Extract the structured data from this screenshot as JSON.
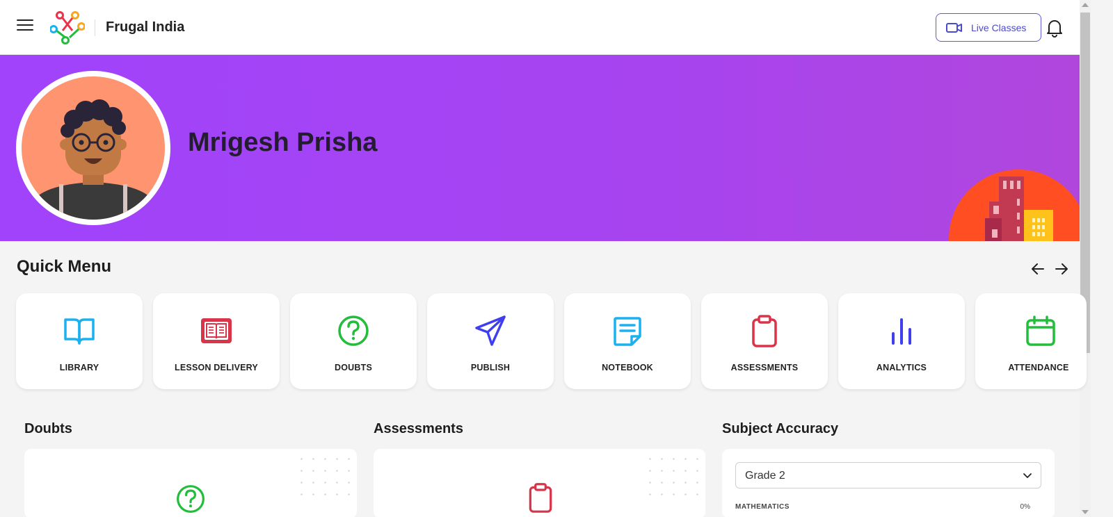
{
  "header": {
    "brand": "Frugal India",
    "live_classes_label": "Live Classes"
  },
  "profile": {
    "name": "Mrigesh Prisha"
  },
  "quick_menu": {
    "title": "Quick Menu",
    "items": [
      {
        "label": "LIBRARY",
        "icon": "book-open-icon",
        "color": "#1ab1f0"
      },
      {
        "label": "LESSON DELIVERY",
        "icon": "book-lesson-icon",
        "color": "#d8344a"
      },
      {
        "label": "DOUBTS",
        "icon": "question-circle-icon",
        "color": "#22bd3b"
      },
      {
        "label": "PUBLISH",
        "icon": "send-icon",
        "color": "#3f3ff0"
      },
      {
        "label": "NOTEBOOK",
        "icon": "notebook-icon",
        "color": "#1ab1f0"
      },
      {
        "label": "ASSESSMENTS",
        "icon": "clipboard-icon",
        "color": "#d8344a"
      },
      {
        "label": "ANALYTICS",
        "icon": "bar-chart-icon",
        "color": "#3f3ff0"
      },
      {
        "label": "ATTENDANCE",
        "icon": "calendar-icon",
        "color": "#22bd3b"
      }
    ]
  },
  "dashboard": {
    "doubts_title": "Doubts",
    "assessments_title": "Assessments",
    "subject_accuracy": {
      "title": "Subject Accuracy",
      "selected_grade": "Grade 2",
      "first_row_label": "MATHEMATICS",
      "first_row_value": "0%"
    }
  },
  "colors": {
    "banner": "#a043fb",
    "accent": "#4a4ad0",
    "building_circle": "#ff4f22"
  }
}
